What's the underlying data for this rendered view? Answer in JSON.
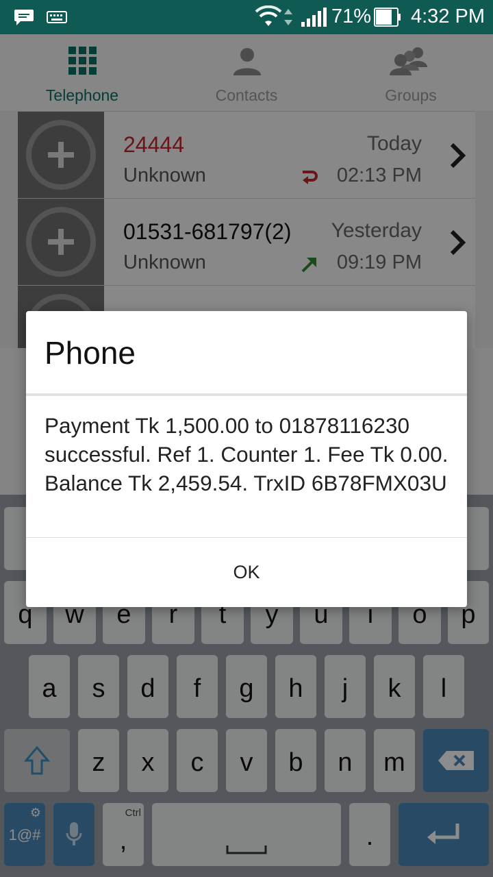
{
  "status_bar": {
    "battery": "71%",
    "time": "4:32 PM"
  },
  "tabs": [
    {
      "label": "Telephone",
      "icon": "dialpad-icon",
      "active": true
    },
    {
      "label": "Contacts",
      "icon": "person-icon",
      "active": false
    },
    {
      "label": "Groups",
      "icon": "group-icon",
      "active": false
    }
  ],
  "calls": [
    {
      "number": "24444",
      "status": "Unknown",
      "date": "Today",
      "time": "02:13 PM",
      "type": "missed",
      "icon": "missed-call-icon"
    },
    {
      "number": "01531-681797(2)",
      "status": "Unknown",
      "date": "Yesterday",
      "time": "09:19 PM",
      "type": "outgoing",
      "icon": "outgoing-call-icon"
    }
  ],
  "dialog": {
    "title": "Phone",
    "message": "Payment Tk 1,500.00 to 01878116230 successful. Ref 1. Counter 1. Fee Tk 0.00. Balance Tk 2,459.54. TrxID 6B78FMX03U",
    "ok_label": "OK"
  },
  "keyboard": {
    "row1": [
      "q",
      "w",
      "e",
      "r",
      "t",
      "y",
      "u",
      "i",
      "o",
      "p"
    ],
    "row2": [
      "a",
      "s",
      "d",
      "f",
      "g",
      "h",
      "j",
      "k",
      "l"
    ],
    "row3": [
      "z",
      "x",
      "c",
      "v",
      "b",
      "n",
      "m"
    ],
    "symbols_label": "1@#",
    "ctrl_hint": "Ctrl",
    "comma_label": ",",
    "period_label": "."
  },
  "colors": {
    "status_bar": "#0f5a52",
    "accent": "#0c6f64",
    "missed": "#c1272d",
    "outgoing": "#2e8b2e",
    "keyboard_action": "#4c88b8"
  }
}
